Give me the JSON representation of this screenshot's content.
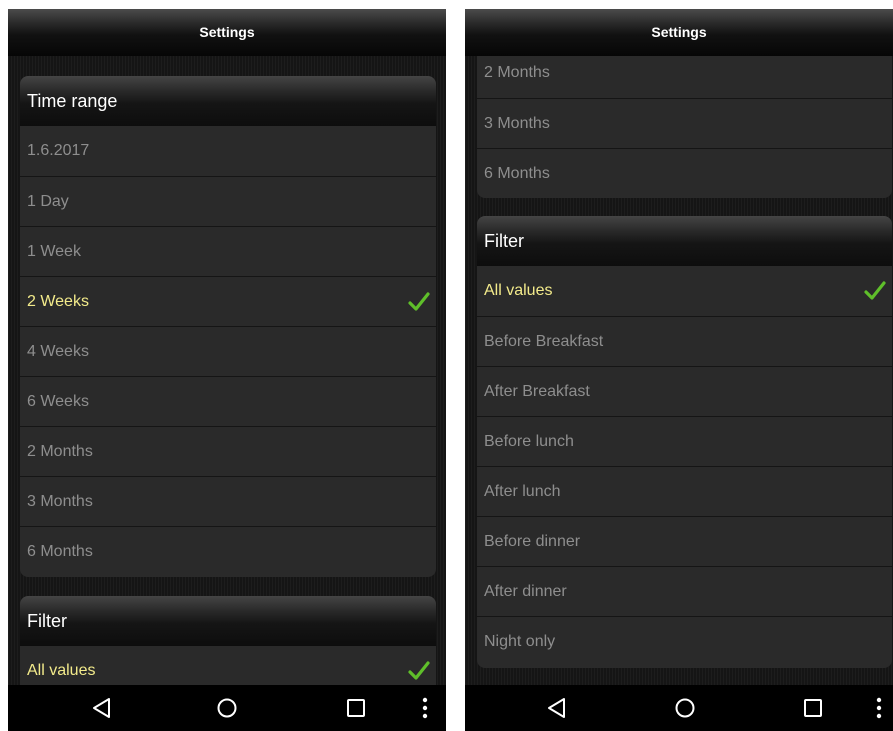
{
  "app_bar": {
    "title": "Settings"
  },
  "left_screen": {
    "time_range": {
      "header": "Time range",
      "options": [
        "1.6.2017",
        "1 Day",
        "1 Week",
        "2 Weeks",
        "4 Weeks",
        "6 Weeks",
        "2 Months",
        "3 Months",
        "6 Months"
      ],
      "selected_index": 3
    },
    "filter": {
      "header": "Filter",
      "options": [
        "All values"
      ],
      "selected_index": 0
    }
  },
  "right_screen": {
    "time_range": {
      "options": [
        "2 Months",
        "3 Months",
        "6 Months"
      ]
    },
    "filter": {
      "header": "Filter",
      "options": [
        "All values",
        "Before Breakfast",
        "After Breakfast",
        "Before lunch",
        "After lunch",
        "Before dinner",
        "After dinner",
        "Night only"
      ],
      "selected_index": 0
    }
  },
  "nav_bar": {
    "icons": [
      "back-icon",
      "home-icon",
      "recents-icon",
      "overflow-menu-icon"
    ]
  },
  "colors": {
    "selected_text": "#f3eb8b",
    "unselected_text": "#8e8e8e",
    "checkmark": "#5fbf2a",
    "panel": "#2a2a2a",
    "background": "#151515"
  }
}
